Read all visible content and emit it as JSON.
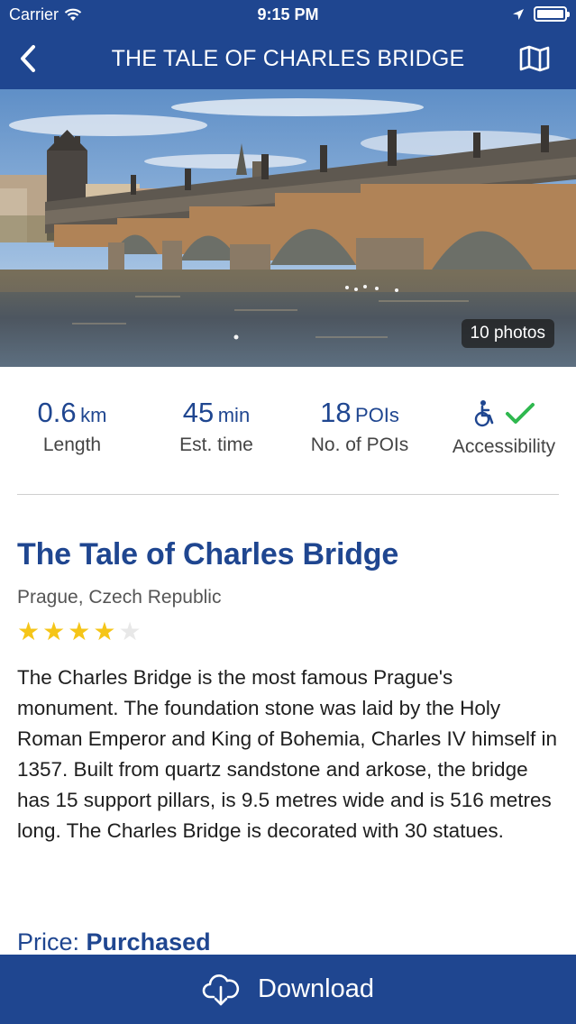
{
  "status_bar": {
    "carrier": "Carrier",
    "time": "9:15 PM",
    "icons": [
      "wifi-icon",
      "location-arrow-icon",
      "battery-icon"
    ]
  },
  "nav": {
    "title": "THE TALE OF CHARLES BRIDGE",
    "back_icon": "chevron-left-icon",
    "map_icon": "map-icon"
  },
  "hero": {
    "photos_label": "10 photos"
  },
  "stats": [
    {
      "value": "0.6",
      "unit": "km",
      "label": "Length"
    },
    {
      "value": "45",
      "unit": "min",
      "label": "Est. time"
    },
    {
      "value": "18",
      "unit": "POIs",
      "label": "No. of POIs"
    },
    {
      "label": "Accessibility",
      "icons": [
        "wheelchair-icon",
        "checkmark-icon"
      ]
    }
  ],
  "tour": {
    "title": "The Tale of Charles Bridge",
    "location": "Prague, Czech Republic",
    "rating": 4,
    "rating_max": 5,
    "description": "The Charles Bridge is the most famous Prague's monument. The foundation stone was laid by the Holy Roman Emperor and King of Bohemia, Charles IV himself in 1357. Built from quartz sandstone and arkose, the bridge has 15 support pillars, is 9.5 metres wide and is 516 metres long. The Charles Bridge is decorated with 30 statues.",
    "price_label": "Price:",
    "price_value": "Purchased"
  },
  "download": {
    "label": "Download",
    "icon": "cloud-download-icon"
  },
  "colors": {
    "brand": "#1f4690",
    "star": "#f5c518",
    "check": "#2fb84f"
  }
}
